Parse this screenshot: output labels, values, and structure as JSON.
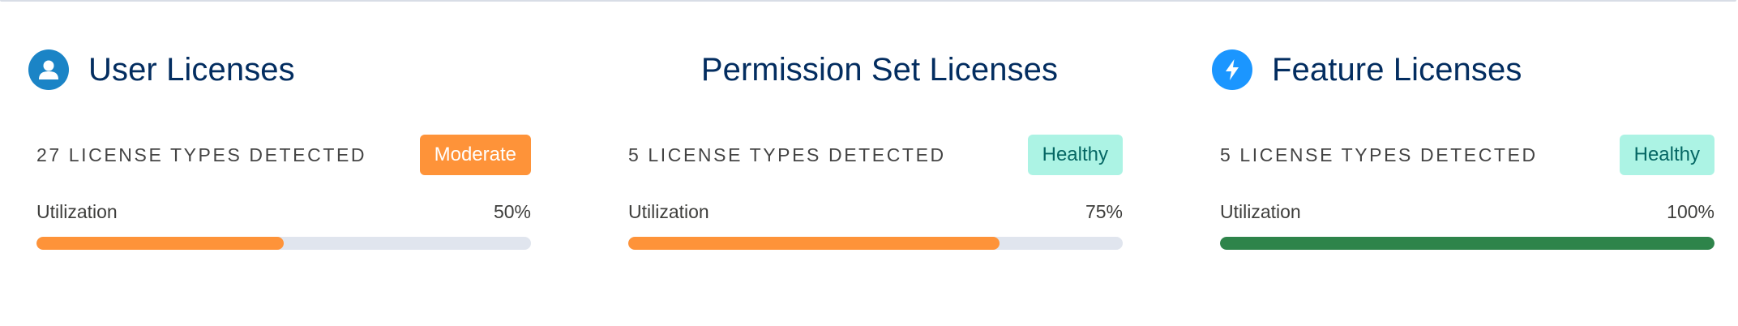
{
  "colors": {
    "title": "#032d60",
    "moderate_badge_bg": "#fe9339",
    "healthy_badge_bg": "#acf3e4",
    "healthy_badge_text": "#056764",
    "bar_orange": "#fe9339",
    "bar_green": "#2e844a",
    "bar_track": "#e0e5ee",
    "user_icon_bg": "#1b84c6",
    "bolt_icon_bg": "#1b96ff"
  },
  "cards": [
    {
      "id": "user",
      "title": "User Licenses",
      "icon": "user-icon",
      "detected": "27 LICENSE TYPES DETECTED",
      "status": "Moderate",
      "utilization_label": "Utilization",
      "utilization_value": "50%",
      "utilization_fraction": 0.5,
      "bar_color": "#fe9339"
    },
    {
      "id": "permission-set",
      "title": "Permission Set Licenses",
      "icon": "",
      "detected": "5 LICENSE TYPES DETECTED",
      "status": "Healthy",
      "utilization_label": "Utilization",
      "utilization_value": "75%",
      "utilization_fraction": 0.75,
      "bar_color": "#fe9339"
    },
    {
      "id": "feature",
      "title": "Feature Licenses",
      "icon": "bolt-icon",
      "detected": "5 LICENSE TYPES DETECTED",
      "status": "Healthy",
      "utilization_label": "Utilization",
      "utilization_value": "100%",
      "utilization_fraction": 1.0,
      "bar_color": "#2e844a"
    }
  ]
}
